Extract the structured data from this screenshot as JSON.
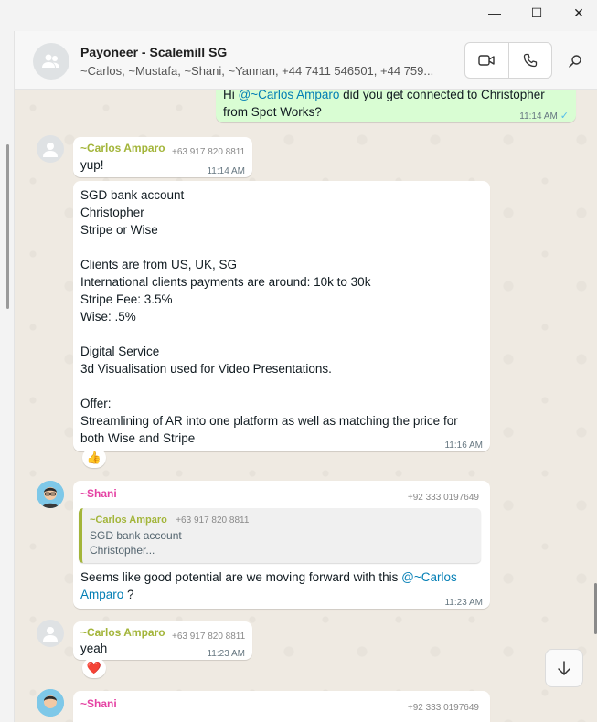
{
  "window": {
    "minimize": "—",
    "maximize": "☐",
    "close": "✕"
  },
  "header": {
    "title": "Payoneer - Scalemill SG",
    "members": "~Carlos, ~Mustafa, ~Shani, ~Yannan, +44 7411 546501, +44 759...",
    "icons": [
      "group-avatar-icon",
      "video-icon",
      "phone-icon",
      "search-icon"
    ]
  },
  "messages": {
    "m0": {
      "prefix": "Hi ",
      "mention": "@~Carlos Amparo",
      "rest": " did you get connected to Christopher",
      "line2": "from Spot Works?",
      "time": "11:14 AM",
      "check": "✓"
    },
    "m1": {
      "sender": "~Carlos Amparo",
      "phone": "+63 917 820 8811",
      "text": "yup!",
      "time": "11:14 AM"
    },
    "m2": {
      "lines": [
        "SGD bank account",
        "Christopher",
        "Stripe or Wise",
        "",
        "Clients are from US, UK, SG",
        "International clients payments are around: 10k to 30k",
        "Stripe Fee: 3.5%",
        "Wise: .5%",
        "",
        "Digital Service",
        "3d Visualisation used for Video Presentations.",
        "",
        "Offer:",
        "Streamlining of AR into one platform as well as matching the price for",
        "both Wise and Stripe"
      ],
      "time": "11:16 AM",
      "reaction": "👍"
    },
    "m3": {
      "sender": "~Shani",
      "phone": "+92 333 0197649",
      "quote": {
        "sender": "~Carlos Amparo",
        "phone": "+63 917 820 8811",
        "line1": "SGD bank account",
        "line2": "Christopher..."
      },
      "text1": "Seems like good potential are we moving forward with this ",
      "mention1": "@~Carlos",
      "mention2": "Amparo",
      "text2": " ?",
      "time": "11:23 AM"
    },
    "m4": {
      "sender": "~Carlos Amparo",
      "phone": "+63 917 820 8811",
      "text": "yeah",
      "time": "11:23 AM",
      "reaction": "❤️"
    },
    "m5": {
      "sender": "~Shani",
      "phone": "+92 333 0197649"
    }
  },
  "colors": {
    "carlos": "#a3b53a",
    "shani": "#e542a3",
    "outgoing": "#d9fdd3",
    "mention": "#027eb5"
  }
}
